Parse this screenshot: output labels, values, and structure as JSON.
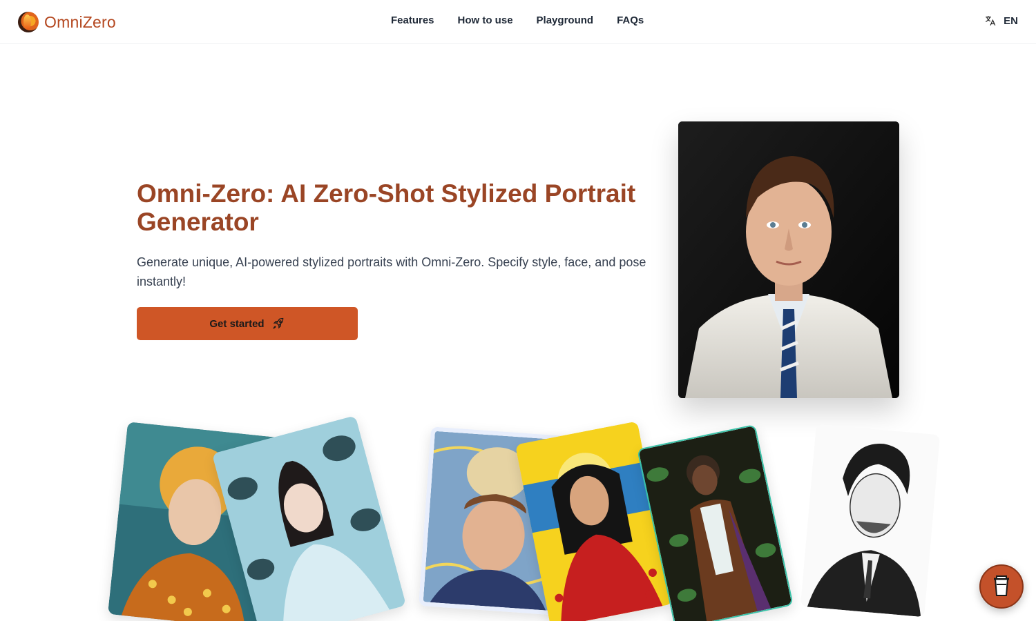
{
  "brand": {
    "name": "OmniZero",
    "accent": "#cf5626",
    "title_color": "#9a4525"
  },
  "nav": {
    "items": [
      {
        "label": "Features"
      },
      {
        "label": "How to use"
      },
      {
        "label": "Playground"
      },
      {
        "label": "FAQs"
      }
    ]
  },
  "language": {
    "icon": "translate-icon",
    "label": "EN"
  },
  "hero": {
    "title": "Omni-Zero: AI Zero-Shot Stylized Portrait Generator",
    "subtitle": "Generate unique, AI-powered stylized portraits with Omni-Zero. Specify style, face, and pose instantly!",
    "cta_label": "Get started",
    "cta_icon": "rocket-icon"
  },
  "gallery": {
    "styles": [
      "klimt-style",
      "botanical-style",
      "van-gogh-style",
      "pop-art-style",
      "jungle-style",
      "ink-sketch-style"
    ]
  },
  "support_button": {
    "icon": "coffee-cup-icon"
  }
}
